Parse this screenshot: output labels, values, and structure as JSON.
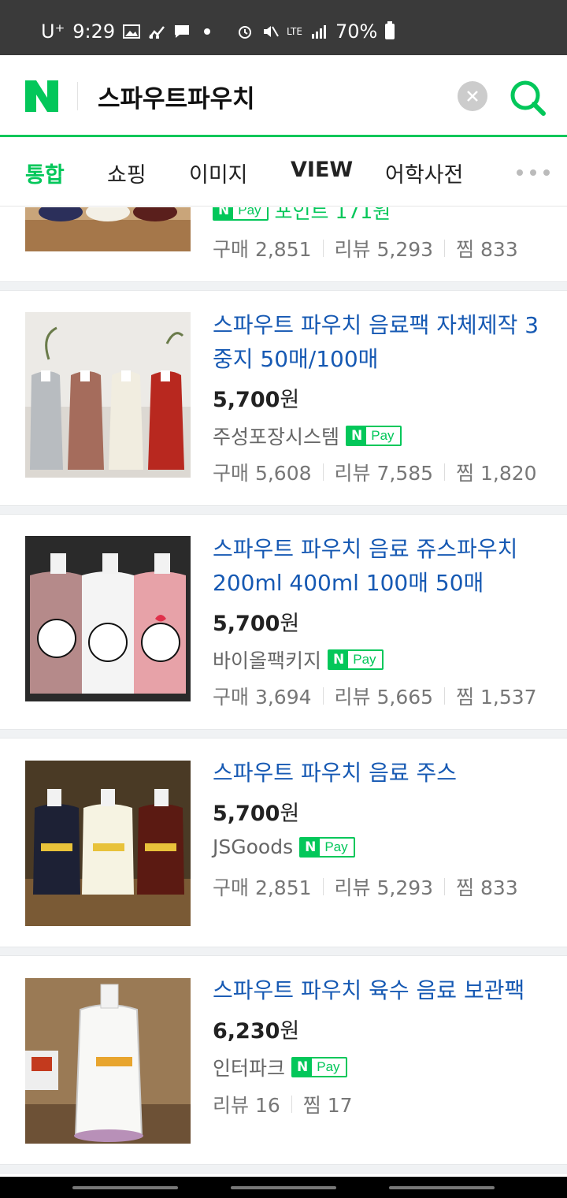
{
  "status_bar": {
    "carrier": "U⁺",
    "time": "9:29",
    "network": "LTE",
    "battery": "70%"
  },
  "search": {
    "query": "스파우트파우치",
    "logo_letter": "N"
  },
  "tabs": [
    "통합",
    "쇼핑",
    "이미지",
    "VIEW",
    "어학사전"
  ],
  "products": [
    {
      "seller_text": "포인트 171원",
      "stats": [
        "구매 2,851",
        "리뷰 5,293",
        "찜 833"
      ]
    },
    {
      "title": "스파우트 파우치 음료팩 자체제작 3중지 50매/100매",
      "price": "5,700",
      "currency": "원",
      "seller": "주성포장시스템",
      "stats": [
        "구매 5,608",
        "리뷰 7,585",
        "찜 1,820"
      ]
    },
    {
      "title": "스파우트 파우치 음료 쥬스파우치 200ml 400ml 100매 50매",
      "price": "5,700",
      "currency": "원",
      "seller": "바이올팩키지",
      "stats": [
        "구매 3,694",
        "리뷰 5,665",
        "찜 1,537"
      ]
    },
    {
      "title": "스파우트 파우치 음료 주스",
      "price": "5,700",
      "currency": "원",
      "seller": "JSGoods",
      "stats": [
        "구매 2,851",
        "리뷰 5,293",
        "찜 833"
      ]
    },
    {
      "title": "스파우트 파우치 육수 음료 보관팩",
      "price": "6,230",
      "currency": "원",
      "seller": "인터파크",
      "stats": [
        "리뷰 16",
        "찜 17"
      ]
    }
  ],
  "npay": {
    "n": "N",
    "pay": "Pay"
  },
  "colors": {
    "naver_green": "#03c75a",
    "title_blue": "#1659b3"
  }
}
